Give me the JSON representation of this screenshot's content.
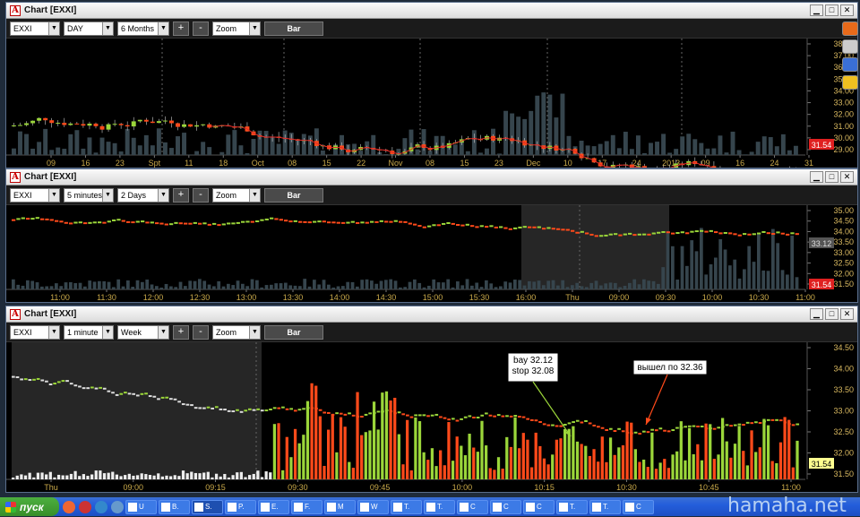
{
  "taskbar": {
    "start_label": "пуск",
    "items": [
      "U",
      "B.",
      "S.",
      "P.",
      "E.",
      "F.",
      "M",
      "W",
      "T.",
      "T.",
      "C",
      "C",
      "C",
      "T.",
      "T.",
      "C"
    ]
  },
  "watermark": "hamaha.net",
  "windows": [
    {
      "title": "Chart [EXXI]",
      "symbol": "EXXI",
      "interval": "DAY",
      "range": "6 Months",
      "mode": "Zoom",
      "chart_type_label": "Bar",
      "minus": "-",
      "plus": "+",
      "price_labels": [
        "38.00",
        "37.00",
        "36.00",
        "35.00",
        "34.00",
        "33.00",
        "32.00",
        "31.00",
        "30.00",
        "29.00"
      ],
      "last_price": "31.54",
      "time_labels": [
        "09",
        "16",
        "23",
        "Spt",
        "11",
        "18",
        "Oct",
        "08",
        "15",
        "22",
        "Nov",
        "08",
        "15",
        "23",
        "Dec",
        "10",
        "17",
        "24",
        "2013",
        "09",
        "16",
        "24",
        "31"
      ]
    },
    {
      "title": "Chart [EXXI]",
      "symbol": "EXXI",
      "interval": "5 minutes",
      "range": "2 Days",
      "mode": "Zoom",
      "chart_type_label": "Bar",
      "minus": "-",
      "plus": "+",
      "price_labels": [
        "35.00",
        "34.50",
        "34.00",
        "33.50",
        "33.00",
        "32.50",
        "32.00",
        "31.50"
      ],
      "last_price": "31.54",
      "ref_price": "33.12",
      "time_labels": [
        "11:00",
        "11:30",
        "12:00",
        "12:30",
        "13:00",
        "13:30",
        "14:00",
        "14:30",
        "15:00",
        "15:30",
        "16:00",
        "Thu",
        "09:00",
        "09:30",
        "10:00",
        "10:30",
        "11:00"
      ]
    },
    {
      "title": "Chart [EXXI]",
      "symbol": "EXXI",
      "interval": "1 minute",
      "range": "Week",
      "mode": "Zoom",
      "chart_type_label": "Bar",
      "minus": "-",
      "plus": "+",
      "price_labels": [
        "34.50",
        "34.00",
        "33.50",
        "33.00",
        "32.50",
        "32.00",
        "31.50"
      ],
      "last_price": "31.54",
      "time_labels": [
        "Thu",
        "09:00",
        "09:15",
        "09:30",
        "09:45",
        "10:00",
        "10:15",
        "10:30",
        "10:45",
        "11:00"
      ],
      "annotations": [
        {
          "lines": [
            "bay 32.12",
            "stop 32.08"
          ]
        },
        {
          "lines": [
            "вышел по 32.36"
          ]
        }
      ]
    }
  ],
  "colors": {
    "up": "#9bd63a",
    "down": "#ff4a1a",
    "volume": "#36454d",
    "ma": "#d92b2b",
    "price_text": "#d8b860",
    "time_text": "#c9a94a"
  }
}
